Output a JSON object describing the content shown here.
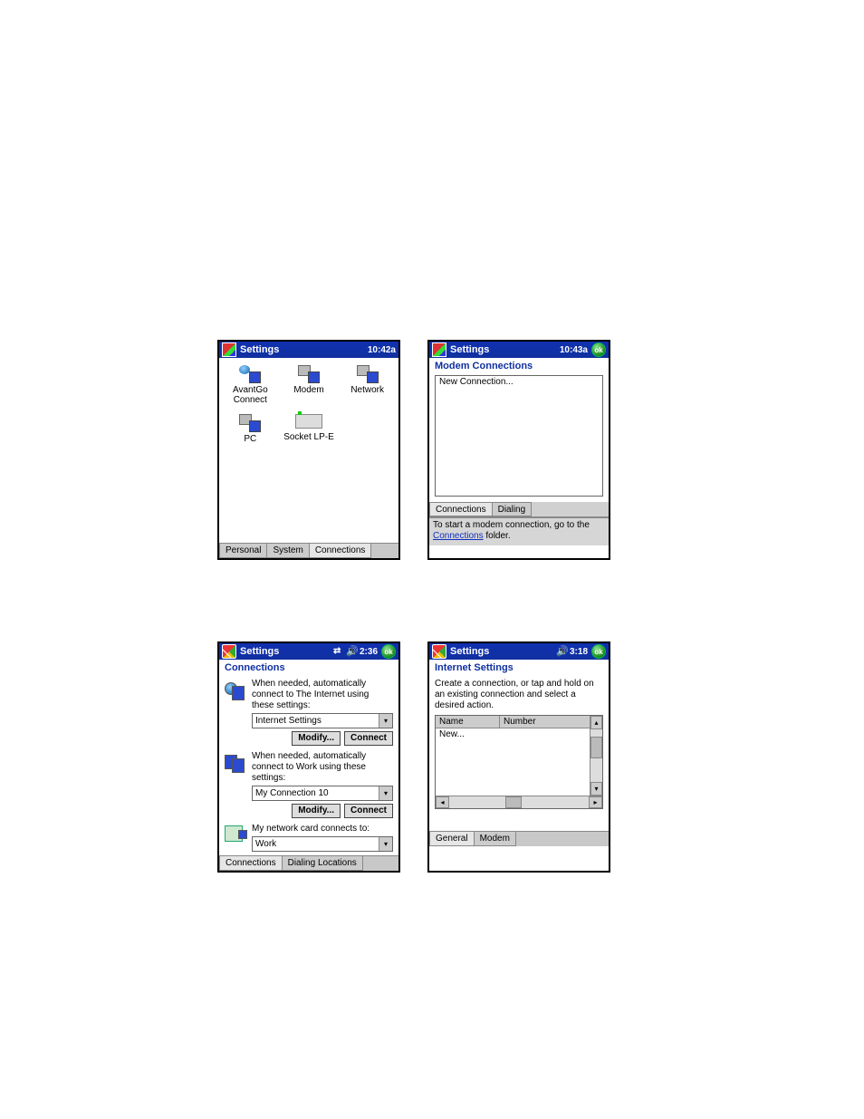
{
  "screen1": {
    "title": "Settings",
    "time": "10:42a",
    "apps": [
      {
        "label": "AvantGo Connect"
      },
      {
        "label": "Modem"
      },
      {
        "label": "Network"
      },
      {
        "label": "PC"
      },
      {
        "label": "Socket LP-E"
      }
    ],
    "tabs": {
      "personal": "Personal",
      "system": "System",
      "connections": "Connections",
      "active": "Connections"
    }
  },
  "screen2": {
    "title": "Settings",
    "time": "10:43a",
    "header": "Modem Connections",
    "list": [
      "New Connection..."
    ],
    "tabs": {
      "connections": "Connections",
      "dialing": "Dialing",
      "active": "Connections"
    },
    "tip_prefix": "To start a modem connection, go to the ",
    "tip_link": "Connections",
    "tip_suffix": " folder."
  },
  "screen3": {
    "title": "Settings",
    "time": "2:36",
    "header": "Connections",
    "internet": {
      "text": "When needed, automatically connect to The Internet using these settings:",
      "value": "Internet Settings",
      "modify": "Modify...",
      "connect": "Connect"
    },
    "work": {
      "text": "When needed, automatically connect to Work using these settings:",
      "value": "My Connection 10",
      "modify": "Modify...",
      "connect": "Connect"
    },
    "card": {
      "text": "My network card connects to:",
      "value": "Work"
    },
    "tabs": {
      "connections": "Connections",
      "dialing": "Dialing Locations",
      "active": "Connections"
    }
  },
  "screen4": {
    "title": "Settings",
    "time": "3:18",
    "header": "Internet Settings",
    "hint": "Create a connection, or tap and hold on an existing connection and select a desired action.",
    "cols": {
      "name": "Name",
      "number": "Number"
    },
    "rows": [
      {
        "name": "New..."
      }
    ],
    "tabs": {
      "general": "General",
      "modem": "Modem",
      "active": "General"
    }
  }
}
